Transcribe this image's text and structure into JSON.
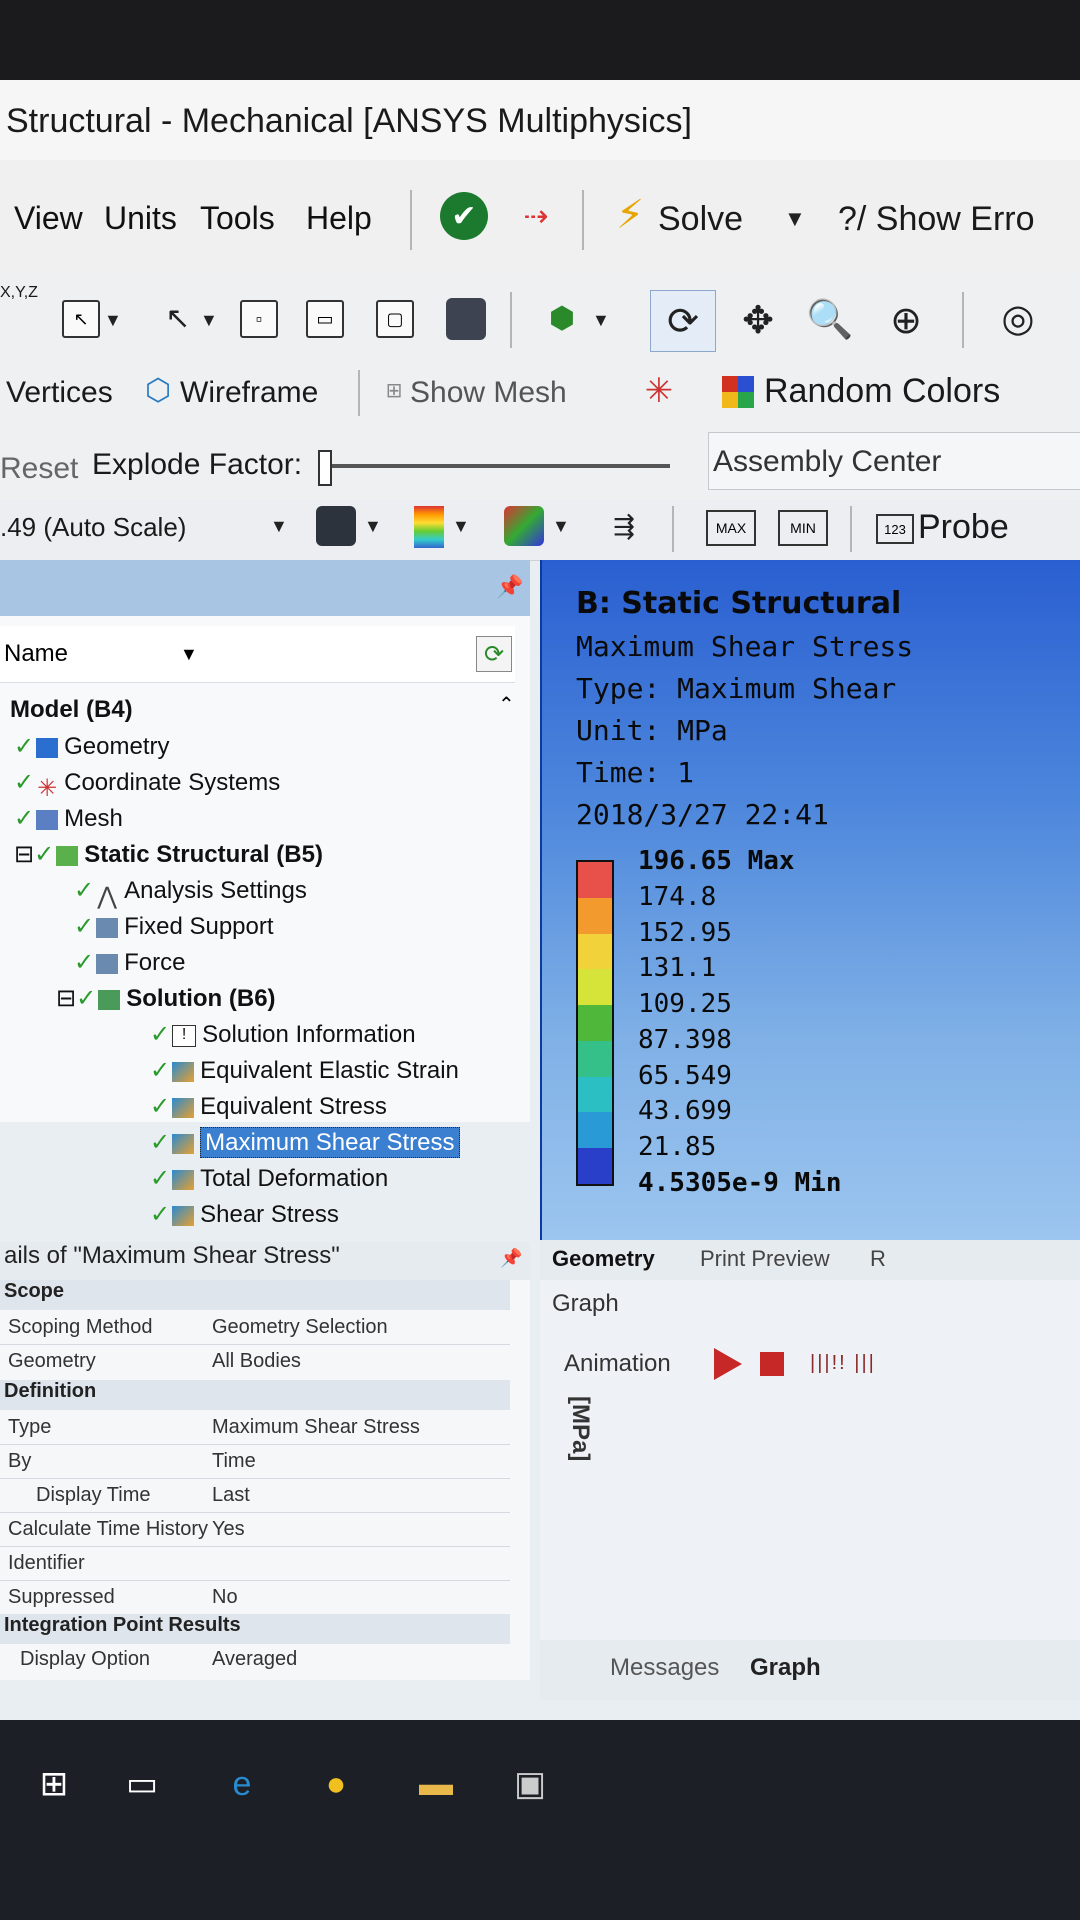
{
  "window": {
    "title": "Structural - Mechanical [ANSYS Multiphysics]"
  },
  "menu": {
    "items": [
      "View",
      "Units",
      "Tools",
      "Help"
    ],
    "solve_label": "Solve",
    "show_errors_label": "?/ Show Erro"
  },
  "toolbar2": {
    "xyz_label": "X,Y,Z"
  },
  "toolbar3": {
    "vertices_label": "Vertices",
    "wireframe_label": "Wireframe",
    "show_mesh_label": "Show Mesh",
    "random_colors_label": "Random Colors"
  },
  "toolbar4": {
    "reset_label": "Reset",
    "explode_factor_label": "Explode Factor:",
    "assembly_center_label": "Assembly Center"
  },
  "toolbar5": {
    "scale_value": ".49 (Auto Scale)",
    "max_label": "MAX",
    "min_label": "MIN",
    "probe_label": "Probe"
  },
  "tree": {
    "name_header": "Name",
    "rows": [
      {
        "label": "Model (B4)",
        "bold": true
      },
      {
        "label": "Geometry"
      },
      {
        "label": "Coordinate Systems"
      },
      {
        "label": "Mesh"
      },
      {
        "label": "Static Structural (B5)",
        "bold": true
      },
      {
        "label": "Analysis Settings"
      },
      {
        "label": "Fixed Support"
      },
      {
        "label": "Force"
      },
      {
        "label": "Solution (B6)",
        "bold": true
      },
      {
        "label": "Solution Information"
      },
      {
        "label": "Equivalent Elastic Strain"
      },
      {
        "label": "Equivalent Stress"
      },
      {
        "label": "Maximum Shear Stress",
        "selected": true
      },
      {
        "label": "Total Deformation"
      },
      {
        "label": "Shear Stress"
      }
    ]
  },
  "details": {
    "title": "ails of \"Maximum Shear Stress\"",
    "scope_group": "Scope",
    "definition_group": "Definition",
    "integration_group": "Integration Point Results",
    "rows": [
      {
        "label": "Scoping Method",
        "value": "Geometry Selection"
      },
      {
        "label": "Geometry",
        "value": "All Bodies"
      },
      {
        "label": "Type",
        "value": "Maximum Shear Stress"
      },
      {
        "label": "By",
        "value": "Time"
      },
      {
        "label": "Display Time",
        "value": "Last"
      },
      {
        "label": "Calculate Time History",
        "value": "Yes"
      },
      {
        "label": "Identifier",
        "value": ""
      },
      {
        "label": "Suppressed",
        "value": "No"
      },
      {
        "label": "Display Option",
        "value": "Averaged"
      }
    ]
  },
  "viewport": {
    "title": "B: Static Structural",
    "line1": "Maximum Shear Stress",
    "line2": "Type: Maximum Shear",
    "line3": "Unit: MPa",
    "line4": "Time: 1",
    "line5": "2018/3/27 22:41",
    "legend": {
      "labels": [
        "196.65 Max",
        "174.8",
        "152.95",
        "131.1",
        "109.25",
        "87.398",
        "65.549",
        "43.699",
        "21.85",
        "4.5305e-9 Min"
      ],
      "colors": [
        "#e8504a",
        "#f29a2e",
        "#f2d23a",
        "#d6e43a",
        "#4fb83a",
        "#35c08a",
        "#2bbfc4",
        "#2a9ad6",
        "#2a3fc9"
      ]
    }
  },
  "tabs": {
    "geometry": "Geometry",
    "print_preview": "Print Preview",
    "r": "R"
  },
  "graph": {
    "title": "Graph",
    "animation_label": "Animation",
    "frames_label": "|||!! |||",
    "unit_label": "[MPa]"
  },
  "bottom_tabs": {
    "messages": "Messages",
    "graph": "Graph"
  }
}
